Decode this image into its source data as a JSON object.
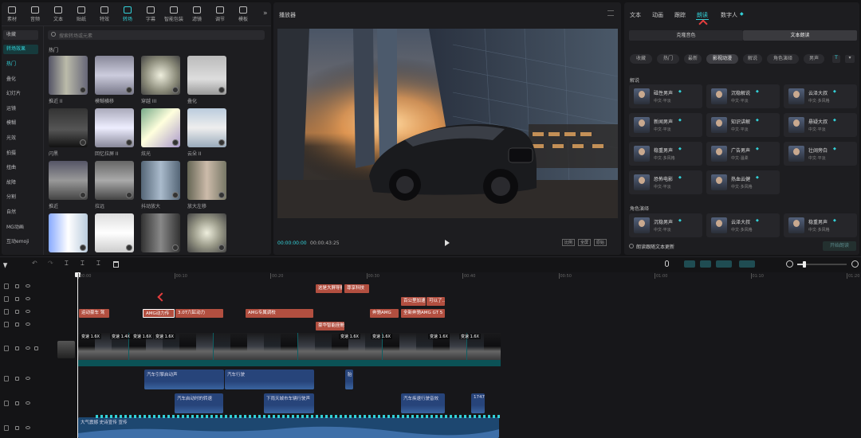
{
  "toolbar": {
    "items": [
      {
        "label": "素材",
        "icon": "media-icon"
      },
      {
        "label": "音频",
        "icon": "audio-icon"
      },
      {
        "label": "文本",
        "icon": "text-icon"
      },
      {
        "label": "贴纸",
        "icon": "sticker-icon"
      },
      {
        "label": "特效",
        "icon": "effects-icon"
      },
      {
        "label": "转场",
        "icon": "transition-icon"
      },
      {
        "label": "字幕",
        "icon": "caption-icon"
      },
      {
        "label": "智能包装",
        "icon": "smart-pack-icon"
      },
      {
        "label": "滤镜",
        "icon": "filter-icon"
      },
      {
        "label": "调节",
        "icon": "adjust-icon"
      },
      {
        "label": "模板",
        "icon": "template-icon"
      }
    ],
    "more": "»"
  },
  "left_sidebar": {
    "items": [
      "收藏",
      "转场效果",
      "热门",
      "叠化",
      "幻灯片",
      "运镜",
      "模糊",
      "光效",
      "拍摄",
      "扭曲",
      "故障",
      "分割",
      "自然",
      "MG动画",
      "互动emoji"
    ]
  },
  "search": {
    "placeholder": "搜索转场或元素"
  },
  "section_title": "热门",
  "thumbnails": [
    {
      "label": "推近 II"
    },
    {
      "label": "模糊横移"
    },
    {
      "label": "穿越 III"
    },
    {
      "label": "叠化"
    },
    {
      "label": "闪黑"
    },
    {
      "label": "回忆拉屏 II"
    },
    {
      "label": "炫光"
    },
    {
      "label": "云朵 II"
    },
    {
      "label": "推近"
    },
    {
      "label": "拉远"
    },
    {
      "label": "抖动放大"
    },
    {
      "label": "放大左移"
    },
    {
      "label": ""
    },
    {
      "label": ""
    },
    {
      "label": ""
    },
    {
      "label": ""
    }
  ],
  "player": {
    "title": "播放器",
    "current_time": "00:00:00:00",
    "total_time": "00:00:43:25",
    "btn_ratio": "比例",
    "btn_full": "全屏",
    "btn_orig": "原始"
  },
  "right_panel": {
    "tabs": [
      "文本",
      "动画",
      "跟踪",
      "朗读",
      "数字人"
    ],
    "active_tab": "朗读",
    "subtabs": [
      "克隆音色",
      "文本朗读"
    ],
    "filters": [
      "收藏",
      "热门",
      "最新",
      "影视动漫",
      "解说",
      "角色演绎",
      "男声"
    ],
    "section_narration": "解说",
    "voices": [
      {
        "name": "磁性男声",
        "sub": "中文·平淡"
      },
      {
        "name": "沉稳解说",
        "sub": "中文·平淡"
      },
      {
        "name": "云泽大叔",
        "sub": "中文·多风格"
      },
      {
        "name": "新闻男声",
        "sub": "中文·平淡"
      },
      {
        "name": "知识讲解",
        "sub": "中文·平淡"
      },
      {
        "name": "悬疑大叔",
        "sub": "中文·平淡"
      },
      {
        "name": "稳重男声",
        "sub": "中文·多风格"
      },
      {
        "name": "广告男声",
        "sub": "中文·温柔"
      },
      {
        "name": "壮阔旁白",
        "sub": "中文·平淡"
      },
      {
        "name": "恐怖电影",
        "sub": "中文·平淡"
      },
      {
        "name": "热血云健",
        "sub": "中文·多风格"
      }
    ],
    "section_role": "角色演绎",
    "role_voices": [
      {
        "name": "沉稳男声",
        "sub": "中文·平淡"
      },
      {
        "name": "云泽大叔",
        "sub": "中文·多风格"
      },
      {
        "name": "稳重男声",
        "sub": "中文·多风格"
      }
    ],
    "footer_check": "朗读跟随文本更新",
    "footer_btn": "开始朗读"
  },
  "timeline": {
    "ruler": [
      "00:00",
      "00:10",
      "00:20",
      "00:30",
      "00:40",
      "00:50",
      "01:00",
      "01:10",
      "01:20"
    ],
    "text_clips": [
      {
        "label": "这是大屏导航"
      },
      {
        "label": "尊享科技"
      },
      {
        "label": "百公里加速"
      },
      {
        "label": "可以了..."
      },
      {
        "label": "运动豪车 驾"
      },
      {
        "label": "AMG动力传"
      },
      {
        "label": "3.0T六缸动力"
      },
      {
        "label": "AMG专属调校"
      },
      {
        "label": "奔驰AMG"
      },
      {
        "label": "全新奔驰AMG GT 5"
      },
      {
        "label": "豪华智能座舱"
      }
    ],
    "video_labels": [
      "变速 1.6X",
      "变速 1.4X",
      "变速 1.6X",
      "变速 1.6X",
      "变速 1.6X",
      "变速 1.6X",
      "变速 1.6X",
      "变速 1.6X"
    ],
    "audio_row1": [
      {
        "label": "汽车引擎启动声"
      },
      {
        "label": "汽车行驶"
      },
      {
        "label": "胎"
      }
    ],
    "audio_row2": [
      {
        "label": "汽车启动时的转速"
      },
      {
        "label": "下雨天城市车辆行驶声"
      },
      {
        "label": "汽车疾速行驶音效"
      },
      {
        "label": "17472"
      }
    ],
    "music_label": "大气震撼 史诗宣传 宣传"
  },
  "colors": {
    "accent": "#33d1d8",
    "text_clip": "#b24f40",
    "audio_clip": "#27447a",
    "video_track": "#0f5f63"
  }
}
